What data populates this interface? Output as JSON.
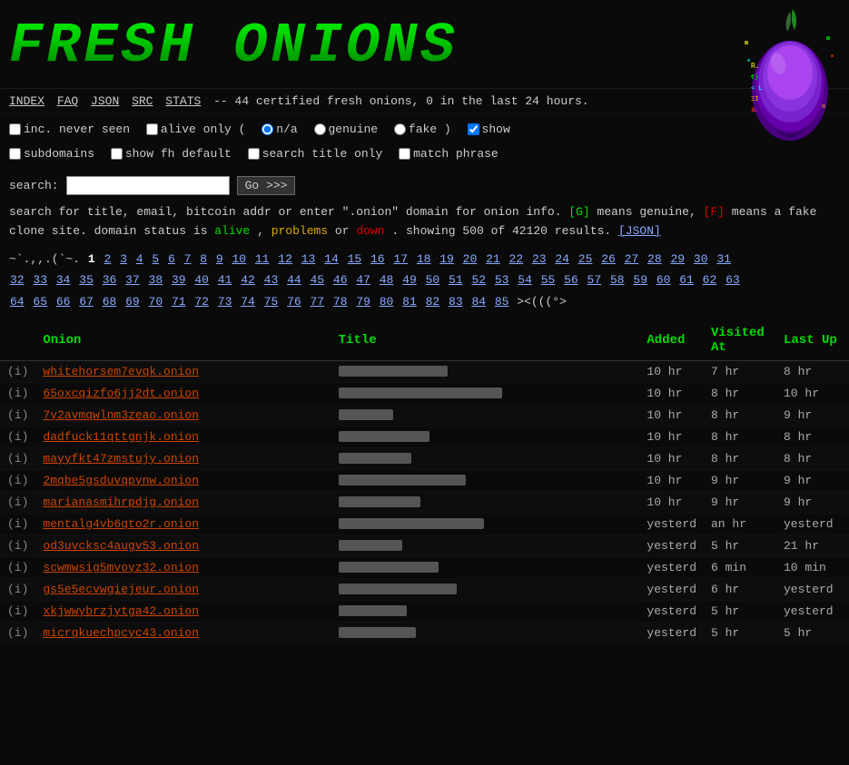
{
  "header": {
    "title": "FRESH ONIONS",
    "tagline": "-- 44 certified fresh onions, 0 in the last 24 hours."
  },
  "nav": {
    "links": [
      "INDEX",
      "FAQ",
      "JSON",
      "SRC",
      "STATS"
    ]
  },
  "options": {
    "inc_never_seen_label": "inc. never seen",
    "alive_only_label": "alive only (",
    "na_label": "n/a",
    "genuine_label": "genuine",
    "fake_label": "fake )",
    "show_label": "show",
    "subdomains_label": "subdomains",
    "show_fh_label": "show fh default",
    "search_title_label": "search title only",
    "match_phrase_label": "match phrase"
  },
  "search": {
    "label": "search:",
    "placeholder": "",
    "button_label": "Go >>>"
  },
  "info": {
    "line1": "search for title, email, bitcoin addr or enter \".onion\" domain for onion info.",
    "genuine_badge": "[G]",
    "genuine_desc": "means genuine,",
    "fake_badge": "[F]",
    "fake_desc": "means a fake clone site. domain status is",
    "alive_word": "alive",
    "problems_word": "problems",
    "or_word": "or",
    "down_word": "down",
    "showing_text": ". showing 500 of 42120 results.",
    "json_link": "[JSON]"
  },
  "pagination": {
    "dots1": "~`.,,.(~`.",
    "current": "1",
    "pages": [
      "2",
      "3",
      "4",
      "5",
      "6",
      "7",
      "8",
      "9",
      "10",
      "11",
      "12",
      "13",
      "14",
      "15",
      "16",
      "17",
      "18",
      "19",
      "20",
      "21",
      "22",
      "23",
      "24",
      "25",
      "26",
      "27",
      "28",
      "29",
      "30",
      "31",
      "32",
      "33",
      "34",
      "35",
      "36",
      "37",
      "38",
      "39",
      "40",
      "41",
      "42",
      "43",
      "44",
      "45",
      "46",
      "47",
      "48",
      "49",
      "50",
      "51",
      "52",
      "53",
      "54",
      "55",
      "56",
      "57",
      "58",
      "59",
      "60",
      "61",
      "62",
      "63",
      "64",
      "65",
      "66",
      "67",
      "68",
      "69",
      "70",
      "71",
      "72",
      "73",
      "74",
      "75",
      "76",
      "77",
      "78",
      "79",
      "80",
      "81",
      "82",
      "83",
      "84",
      "85"
    ],
    "smiley": "><(((°>"
  },
  "table": {
    "headers": {
      "onion": "Onion",
      "title": "Title",
      "added": "Added",
      "visited": "Visited At",
      "lastup": "Last Up"
    },
    "rows": [
      {
        "info": "(i)",
        "onion": "whitehorsem7evqk.onion",
        "title": "",
        "added": "10 hr",
        "visited": "7 hr",
        "lastup": "8 hr"
      },
      {
        "info": "(i)",
        "onion": "65oxcqizfo6jj2dt.onion",
        "title": "",
        "added": "10 hr",
        "visited": "8 hr",
        "lastup": "10 hr"
      },
      {
        "info": "(i)",
        "onion": "7y2avmqwlnm3zeao.onion",
        "title": "",
        "added": "10 hr",
        "visited": "8 hr",
        "lastup": "9 hr"
      },
      {
        "info": "(i)",
        "onion": "dadfuck11qttgnjk.onion",
        "title": "",
        "added": "10 hr",
        "visited": "8 hr",
        "lastup": "8 hr"
      },
      {
        "info": "(i)",
        "onion": "mayyfkt47zmstujy.onion",
        "title": "",
        "added": "10 hr",
        "visited": "8 hr",
        "lastup": "8 hr"
      },
      {
        "info": "(i)",
        "onion": "2mqbe5gsduvqpynw.onion",
        "title": "",
        "added": "10 hr",
        "visited": "9 hr",
        "lastup": "9 hr"
      },
      {
        "info": "(i)",
        "onion": "marianasmihrpdjg.onion",
        "title": "",
        "added": "10 hr",
        "visited": "9 hr",
        "lastup": "9 hr"
      },
      {
        "info": "(i)",
        "onion": "mentalg4vb6qto2r.onion",
        "title": "",
        "added": "yesterd",
        "visited": "an hr",
        "lastup": "yesterd"
      },
      {
        "info": "(i)",
        "onion": "od3uvcksc4augv53.onion",
        "title": "",
        "added": "yesterd",
        "visited": "5 hr",
        "lastup": "21 hr"
      },
      {
        "info": "(i)",
        "onion": "scwmwsig5mvoyz32.onion",
        "title": "",
        "added": "yesterd",
        "visited": "6 min",
        "lastup": "10 min"
      },
      {
        "info": "(i)",
        "onion": "gs5e5ecvwgiejeur.onion",
        "title": "",
        "added": "yesterd",
        "visited": "6 hr",
        "lastup": "yesterd"
      },
      {
        "info": "(i)",
        "onion": "xkjwwybrzjytga42.onion",
        "title": "",
        "added": "yesterd",
        "visited": "5 hr",
        "lastup": "yesterd"
      },
      {
        "info": "(i)",
        "onion": "micrqkuechpcyc43.onion",
        "title": "",
        "added": "yesterd",
        "visited": "5 hr",
        "lastup": "5 hr"
      }
    ]
  },
  "colors": {
    "bg": "#0a0a0a",
    "text": "#cccccc",
    "link": "#88aaff",
    "onion_link": "#cc4400",
    "green": "#00dd00",
    "red": "#dd0000",
    "header_green": "#00ff00"
  }
}
